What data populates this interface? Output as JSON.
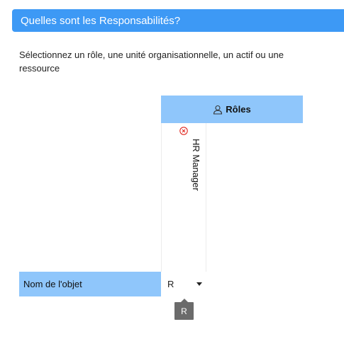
{
  "header": {
    "title": "Quelles sont les Responsabilités?"
  },
  "instruction": "Sélectionnez un rôle, une unité organisationnelle, un actif ou une ressource",
  "roles": {
    "header_label": "Rôles",
    "header_icon": "person-icon",
    "items": [
      {
        "name": "HR Manager",
        "remove_icon": "remove-circle-icon"
      }
    ]
  },
  "matrix": {
    "row_label": "Nom de l'objet",
    "selected_value": "R",
    "tooltip": "R"
  },
  "colors": {
    "header_bg": "#3d99f5",
    "cell_bg": "#8fc6fb",
    "remove_icon": "#e0261f",
    "tooltip_bg": "#6b6b6b"
  }
}
